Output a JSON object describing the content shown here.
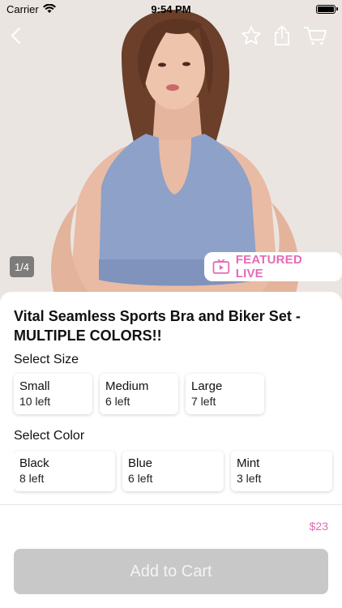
{
  "status_bar": {
    "carrier": "Carrier",
    "time": "9:54 PM"
  },
  "nav": {
    "back_icon": "back-chevron-icon",
    "favorite_icon": "star-icon",
    "share_icon": "share-icon",
    "cart_icon": "cart-icon"
  },
  "gallery": {
    "page_indicator": "1/4",
    "featured_label": "FEATURED LIVE",
    "featured_icon": "tv-play-icon"
  },
  "product": {
    "title": "Vital Seamless Sports Bra and Biker Set - MULTIPLE COLORS!!"
  },
  "size": {
    "label": "Select Size",
    "options": [
      {
        "name": "Small",
        "stock": "10 left"
      },
      {
        "name": "Medium",
        "stock": "6 left"
      },
      {
        "name": "Large",
        "stock": "7 left"
      }
    ]
  },
  "color": {
    "label": "Select Color",
    "options": [
      {
        "name": "Black",
        "stock": "8 left"
      },
      {
        "name": "Blue",
        "stock": "6 left"
      },
      {
        "name": "Mint",
        "stock": "3 left"
      }
    ]
  },
  "price": "$23",
  "add_to_cart_label": "Add to Cart",
  "colors": {
    "accent": "#e36bb5",
    "button_disabled": "#c8c8c8"
  }
}
